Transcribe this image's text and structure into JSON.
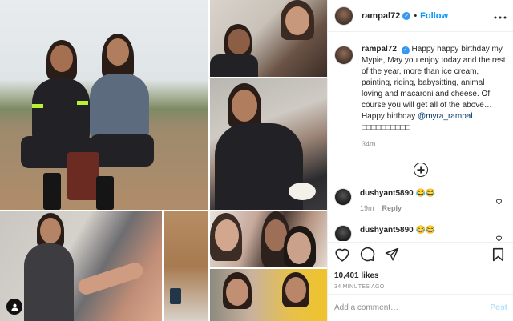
{
  "post": {
    "author": "rampal72",
    "follow_label": "Follow",
    "separator": "•",
    "caption_username": "rampal72",
    "caption_text": "Happy happy birthday my Mypie, May you enjoy today and the rest of the year, more than ice cream, painting, riding, babysitting, animal loving and macaroni and cheese. Of course you will get all of the above… Happy birthday",
    "caption_mention": "@myra_rampal",
    "caption_tail": " □□□□□□□□□□",
    "caption_time": "34m"
  },
  "comments": [
    {
      "username": "dushyant5890",
      "text": "😂😂",
      "time": "19m",
      "reply_label": "Reply"
    },
    {
      "username": "dushyant5890",
      "text": "😂😂",
      "time": "",
      "reply_label": ""
    }
  ],
  "actions": {
    "likes": "10,401 likes",
    "posted": "34 MINUTES AGO"
  },
  "add_comment": {
    "placeholder": "Add a comment…",
    "post_label": "Post"
  },
  "colors": {
    "accent": "#0095f6",
    "verified": "#3897f0",
    "post_disabled": "#b2dffc",
    "muted": "#8e8e8e"
  },
  "icons": [
    "verified-badge-icon",
    "more-options-icon",
    "plus-circle-icon",
    "heart-icon",
    "comment-icon",
    "share-icon",
    "bookmark-icon",
    "user-tag-icon"
  ]
}
